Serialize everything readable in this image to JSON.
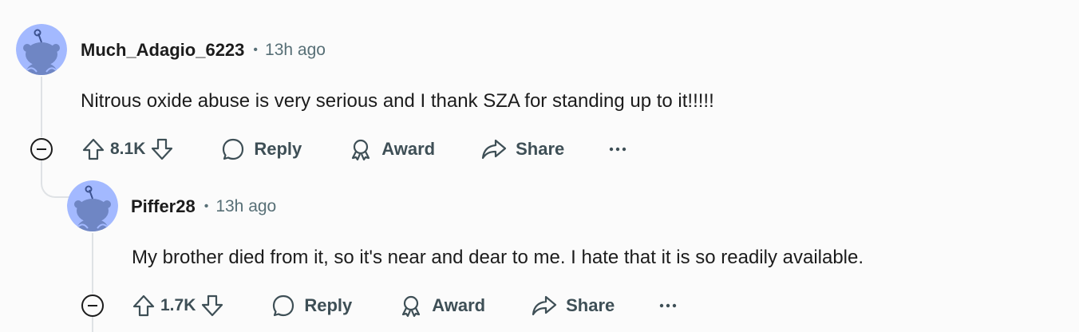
{
  "comments": [
    {
      "author": "Much_Adagio_6223",
      "separator": "•",
      "timestamp": "13h ago",
      "body": "Nitrous oxide abuse is very serious and I thank SZA for standing up to it!!!!!",
      "score": "8.1K",
      "reply_label": "Reply",
      "award_label": "Award",
      "share_label": "Share",
      "avatar_color": "#a3b9ff"
    },
    {
      "author": "Piffer28",
      "separator": "•",
      "timestamp": "13h ago",
      "body": "My brother died from it, so it's near and dear to me. I hate that it is so readily available.",
      "score": "1.7K",
      "reply_label": "Reply",
      "award_label": "Award",
      "share_label": "Share",
      "avatar_color": "#a3b9ff"
    }
  ],
  "icons": {
    "collapse": "collapse-minus-icon",
    "upvote": "upvote-arrow-icon",
    "downvote": "downvote-arrow-icon",
    "reply": "speech-bubble-icon",
    "award": "award-ribbon-icon",
    "share": "share-arrow-icon",
    "more": "ellipsis-icon"
  },
  "colors": {
    "background": "#fbfbfb",
    "text": "#1c1c1c",
    "muted": "#576f76",
    "action": "#3e4f56",
    "thread_line": "#dfe2e5"
  }
}
